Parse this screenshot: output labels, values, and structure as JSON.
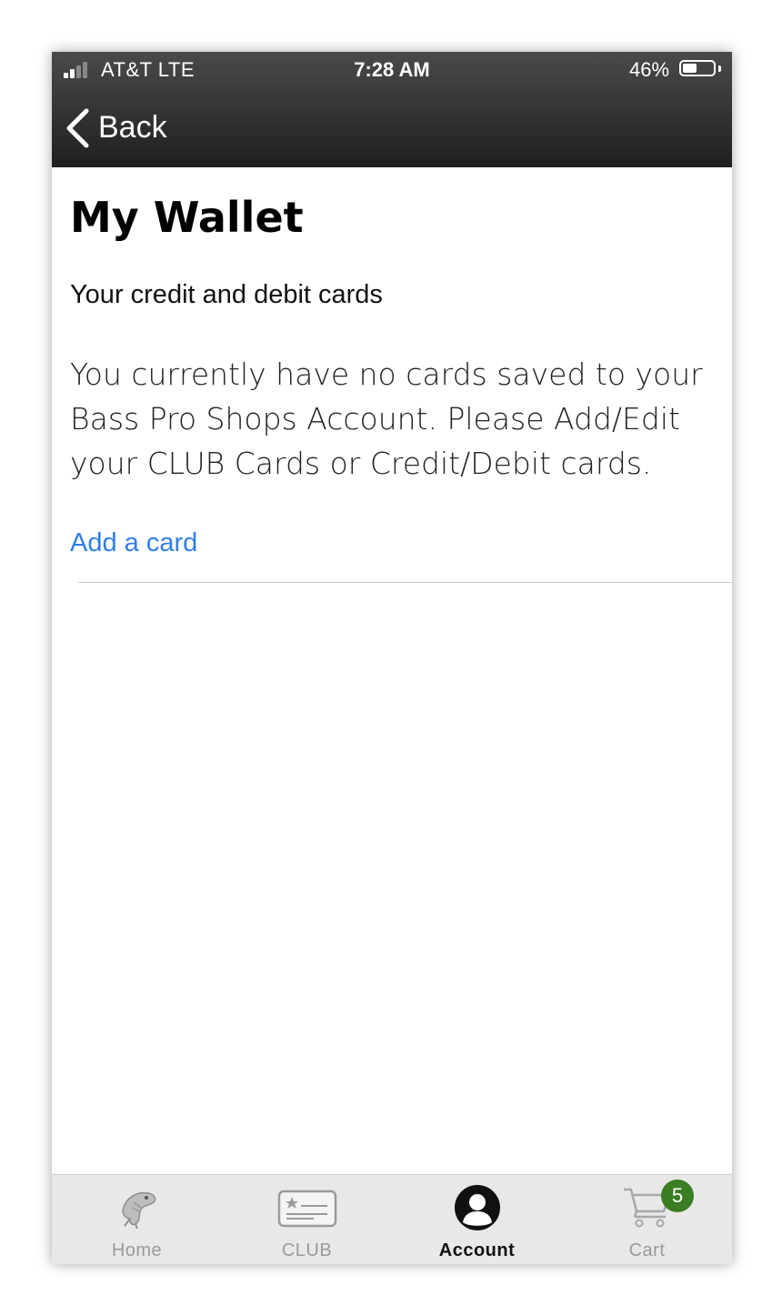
{
  "status_bar": {
    "carrier": "AT&T   LTE",
    "time": "7:28 AM",
    "battery_percent": "46%",
    "battery_level": 0.46,
    "signal_bars": 2
  },
  "nav": {
    "back_label": "Back"
  },
  "page": {
    "title": "My Wallet",
    "subtitle": "Your credit and debit cards",
    "message": "You currently have no cards saved to your Bass Pro Shops Account.  Please Add/Edit your CLUB Cards or Credit/Debit cards.",
    "add_card_label": "Add a card"
  },
  "tabbar": {
    "tabs": [
      {
        "label": "Home",
        "icon": "bass-fish-icon",
        "active": false
      },
      {
        "label": "CLUB",
        "icon": "club-card-icon",
        "active": false
      },
      {
        "label": "Account",
        "icon": "account-icon",
        "active": true
      },
      {
        "label": "Cart",
        "icon": "cart-icon",
        "active": false
      }
    ],
    "cart_badge": "5"
  },
  "colors": {
    "accent_link": "#2f7fe6",
    "badge": "#3b7d22",
    "header_gradient_top": "#4a4a4a",
    "header_gradient_bottom": "#1f1f1f"
  }
}
